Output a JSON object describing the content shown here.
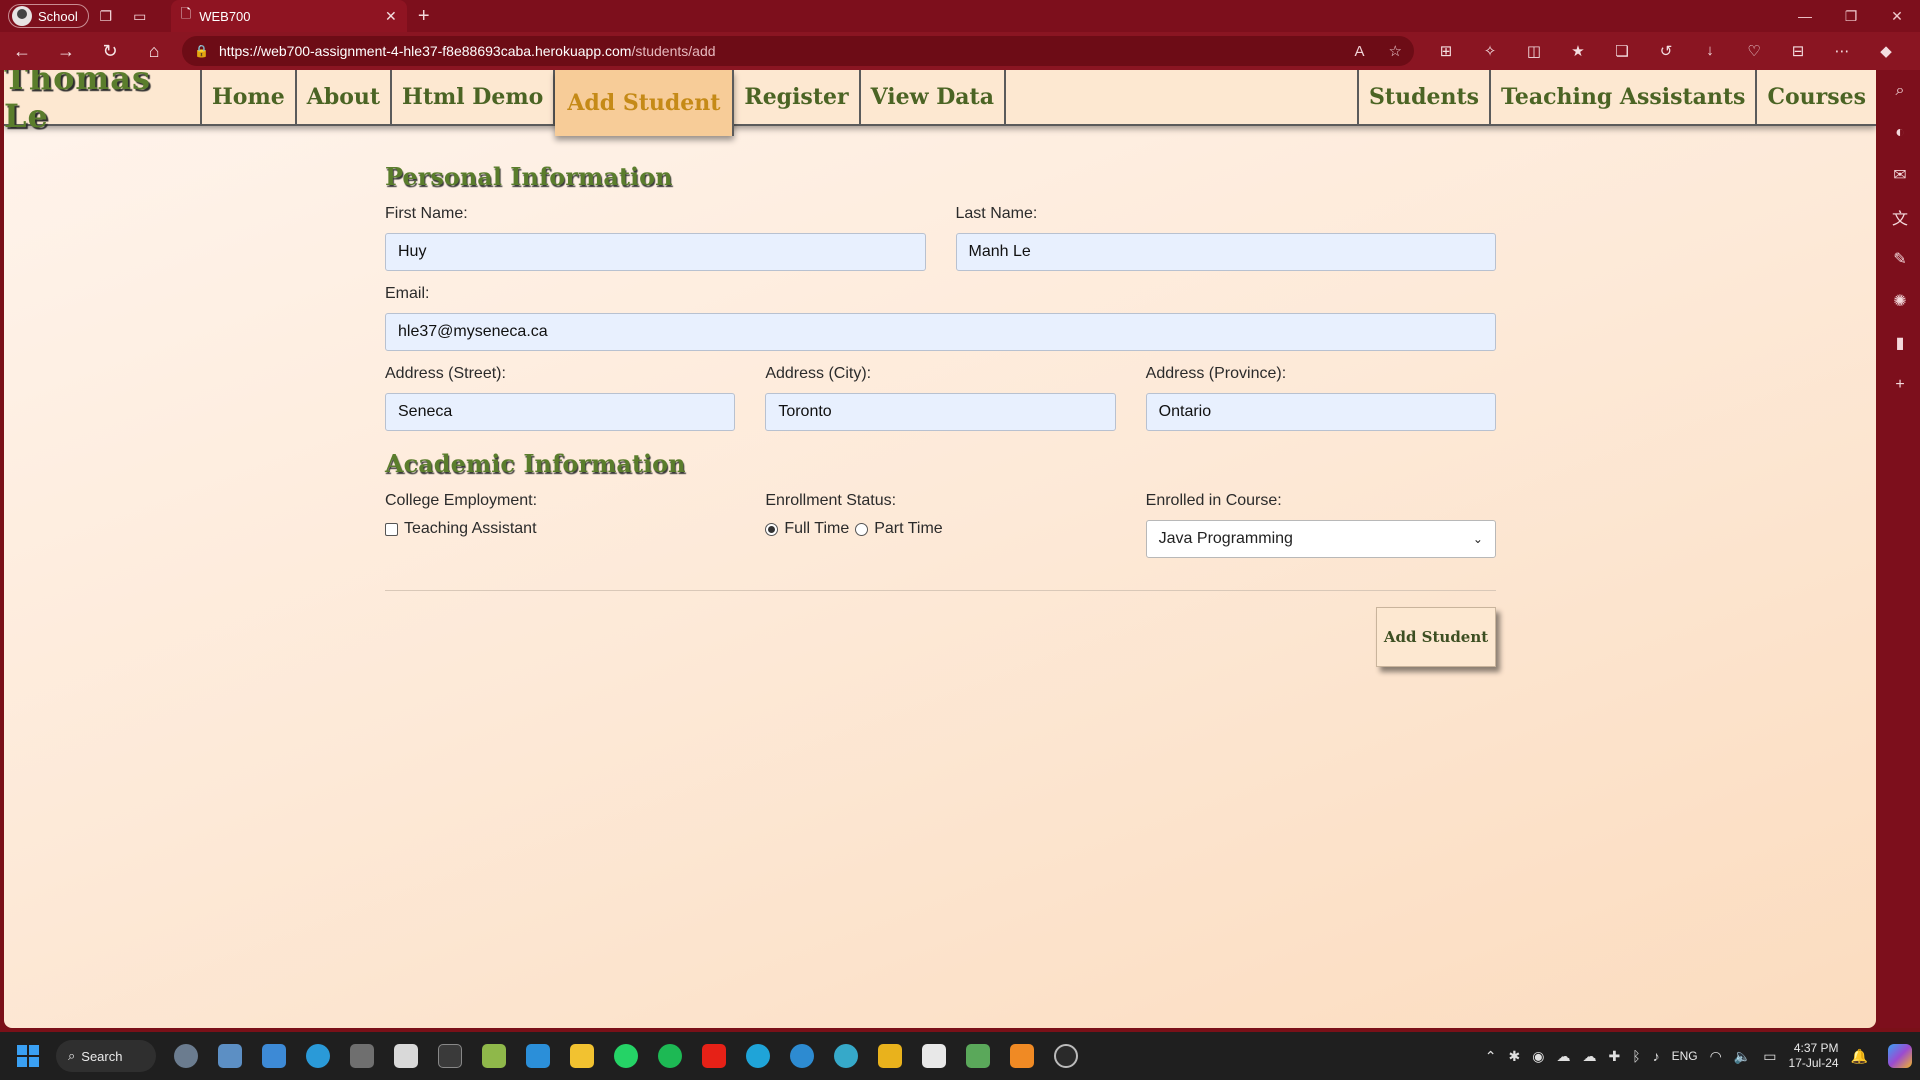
{
  "browser": {
    "profile_label": "School",
    "tab_title": "WEB700",
    "url_host": "https://web700-assignment-4-hle37-f8e88693caba.herokuapp.com",
    "url_path": "/students/add"
  },
  "site_nav": {
    "brand": "Thomas Le",
    "left_items": [
      "Home",
      "About",
      "Html Demo",
      "Add Student",
      "Register",
      "View Data"
    ],
    "right_items": [
      "Students",
      "Teaching Assistants",
      "Courses"
    ]
  },
  "form": {
    "personal_title": "Personal Information",
    "first_name_label": "First Name:",
    "first_name_value": "Huy",
    "last_name_label": "Last Name:",
    "last_name_value": "Manh Le",
    "email_label": "Email:",
    "email_value": "hle37@myseneca.ca",
    "street_label": "Address (Street):",
    "street_value": "Seneca",
    "city_label": "Address (City):",
    "city_value": "Toronto",
    "province_label": "Address (Province):",
    "province_value": "Ontario",
    "academic_title": "Academic Information",
    "employment_label": "College Employment:",
    "ta_label": "Teaching Assistant",
    "status_label": "Enrollment Status:",
    "full_time_label": "Full Time",
    "part_time_label": "Part Time",
    "course_label": "Enrolled in Course:",
    "course_value": "Java Programming",
    "submit_label": "Add Student"
  },
  "taskbar": {
    "search_label": "Search",
    "lang": "ENG",
    "time": "4:37 PM",
    "date": "17-Jul-24"
  }
}
